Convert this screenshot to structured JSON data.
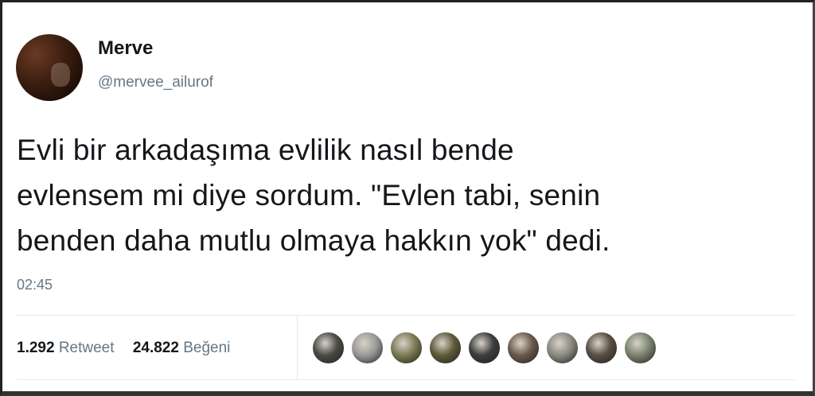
{
  "tweet": {
    "display_name": "Merve",
    "username": "@mervee_ailurof",
    "text_lines": [
      "Evli bir arkadaşıma evlilik nasıl bende",
      "evlensem mi diye sordum. \"Evlen tabi, senin",
      "benden daha mutlu olmaya hakkın yok\" dedi."
    ],
    "time": "02:45"
  },
  "stats": {
    "retweets": "1.292",
    "retweet_label": "Retweet",
    "likes": "24.822",
    "like_label": "Beğeni"
  },
  "likers": [
    {
      "color": "#4a4a45"
    },
    {
      "color": "#9a9a98"
    },
    {
      "color": "#7c7a55"
    },
    {
      "color": "#5d5a3a"
    },
    {
      "color": "#3d3d3d"
    },
    {
      "color": "#6b5a4a"
    },
    {
      "color": "#8a8a80"
    },
    {
      "color": "#5a4e44"
    },
    {
      "color": "#7b8370"
    }
  ]
}
